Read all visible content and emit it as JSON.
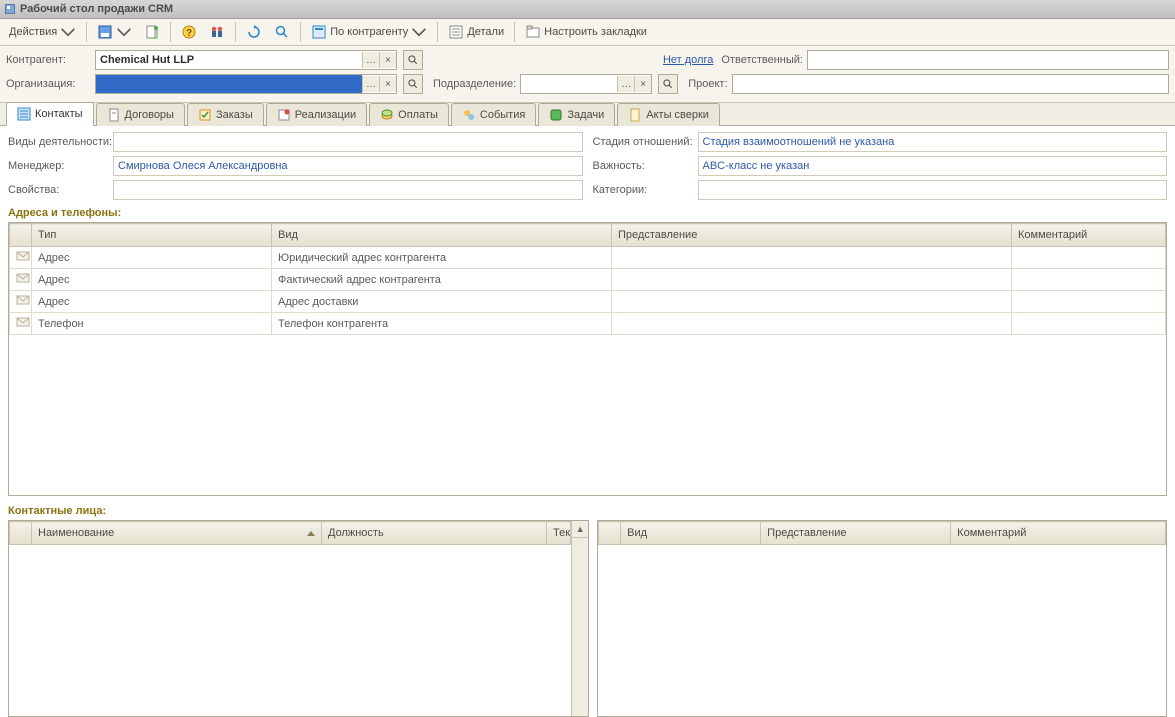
{
  "window": {
    "title": "Рабочий стол продажи CRM"
  },
  "toolbar": {
    "actions": "Действия",
    "by_counterparty": "По контрагенту",
    "details": "Детали",
    "configure_tabs": "Настроить закладки"
  },
  "filters": {
    "counterparty_label": "Контрагент:",
    "counterparty_value": "Chemical Hut LLP",
    "organization_label": "Организация:",
    "organization_value": " ",
    "subdivision_label": "Подразделение:",
    "subdivision_value": "",
    "project_label": "Проект:",
    "no_debt": "Нет долга",
    "responsible_label": "Ответственный:"
  },
  "tabs": [
    {
      "id": "contacts",
      "label": "Контакты",
      "active": true
    },
    {
      "id": "contracts",
      "label": "Договоры"
    },
    {
      "id": "orders",
      "label": "Заказы"
    },
    {
      "id": "realizations",
      "label": "Реализации"
    },
    {
      "id": "payments",
      "label": "Оплаты"
    },
    {
      "id": "events",
      "label": "События"
    },
    {
      "id": "tasks",
      "label": "Задачи"
    },
    {
      "id": "recons",
      "label": "Акты сверки"
    }
  ],
  "info": {
    "activity_label": "Виды деятельности:",
    "activity_value": "",
    "manager_label": "Менеджер:",
    "manager_value": "Смирнова Олеся Александровна",
    "properties_label": "Свойства:",
    "properties_value": "",
    "stage_label": "Стадия отношений:",
    "stage_value": "Стадия взаимоотношений не указана",
    "importance_label": "Важность:",
    "importance_value": "ABC-класс не указан",
    "categories_label": "Категории:",
    "categories_value": ""
  },
  "addresses": {
    "heading": "Адреса и телефоны:",
    "columns": {
      "type": "Тип",
      "kind": "Вид",
      "repr": "Представление",
      "comment": "Комментарий"
    },
    "rows": [
      {
        "type": "Адрес",
        "kind": "Юридический адрес контрагента",
        "repr": "",
        "comment": ""
      },
      {
        "type": "Адрес",
        "kind": "Фактический адрес контрагента",
        "repr": "",
        "comment": ""
      },
      {
        "type": "Адрес",
        "kind": "Адрес доставки",
        "repr": "",
        "comment": ""
      },
      {
        "type": "Телефон",
        "kind": "Телефон контрагента",
        "repr": "",
        "comment": ""
      }
    ]
  },
  "contacts": {
    "heading": "Контактные лица:",
    "left_cols": {
      "name": "Наименование",
      "position": "Должность",
      "state": "Текущее состояние"
    },
    "right_cols": {
      "kind": "Вид",
      "repr": "Представление",
      "comment": "Комментарий"
    }
  }
}
